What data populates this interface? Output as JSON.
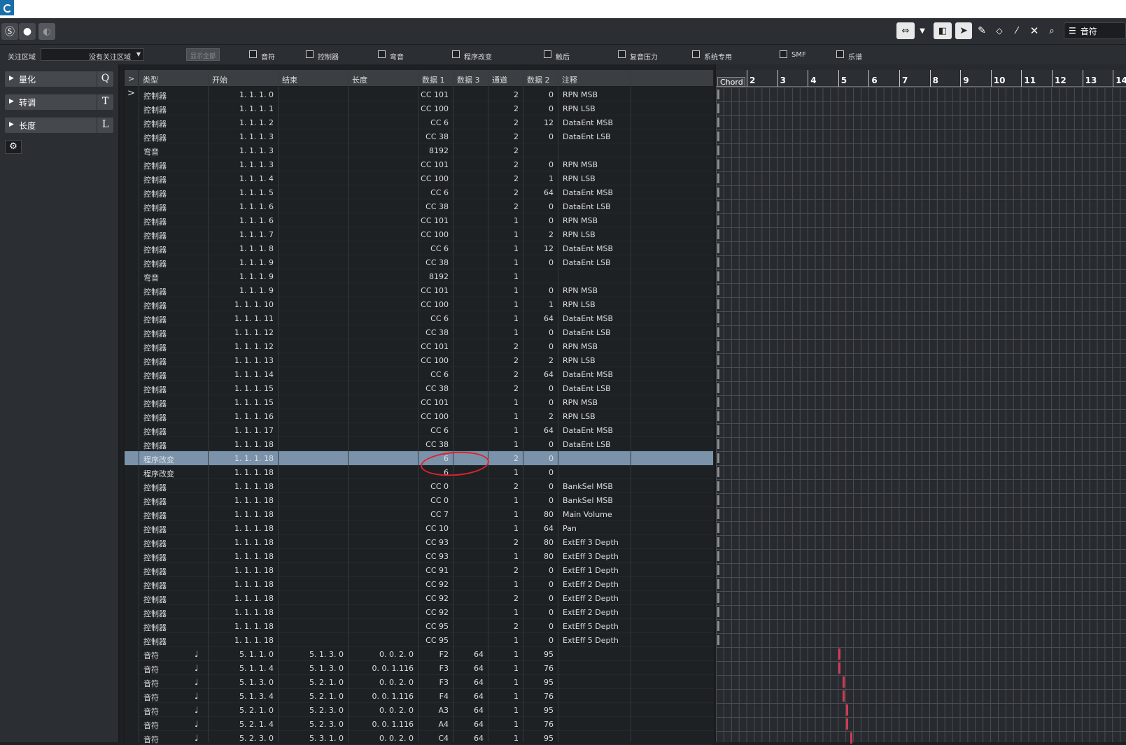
{
  "toolbar": {
    "left_buttons": [
      "solo-icon",
      "record-icon",
      "monitor-icon"
    ],
    "tools": [
      "arrange-icon",
      "chevron-down-icon",
      "mute-icon",
      "pointer-icon",
      "pencil-icon",
      "eraser-icon",
      "knife-icon",
      "cross-icon",
      "zoom-icon"
    ],
    "display_label": "音符"
  },
  "filter": {
    "focus_label": "关注区域",
    "focus_value": "没有关注区域",
    "show_all": "显示全部",
    "checkboxes": [
      "音符",
      "控制器",
      "弯音",
      "程序改变",
      "触后",
      "复音压力",
      "系统专用",
      "SMF",
      "乐谱"
    ]
  },
  "inspector": {
    "sections": [
      {
        "label": "量化",
        "key": "Q"
      },
      {
        "label": "转调",
        "key": "T"
      },
      {
        "label": "长度",
        "key": "L"
      }
    ]
  },
  "list": {
    "expander": ">",
    "columns": [
      "类型",
      "开始",
      "结束",
      "长度",
      "数据 1",
      "数据 3",
      "通道",
      "数据 2",
      "注释"
    ],
    "rows": [
      [
        "控制器",
        "1. 1. 1.   0",
        "",
        "",
        "CC 101",
        "",
        "2",
        "0",
        "RPN MSB"
      ],
      [
        "控制器",
        "1. 1. 1.   1",
        "",
        "",
        "CC 100",
        "",
        "2",
        "0",
        "RPN LSB"
      ],
      [
        "控制器",
        "1. 1. 1.   2",
        "",
        "",
        "CC 6",
        "",
        "2",
        "12",
        "DataEnt MSB"
      ],
      [
        "控制器",
        "1. 1. 1.   3",
        "",
        "",
        "CC 38",
        "",
        "2",
        "0",
        "DataEnt LSB"
      ],
      [
        "弯音",
        "1. 1. 1.   3",
        "",
        "",
        "8192",
        "",
        "2",
        "",
        ""
      ],
      [
        "控制器",
        "1. 1. 1.   3",
        "",
        "",
        "CC 101",
        "",
        "2",
        "0",
        "RPN MSB"
      ],
      [
        "控制器",
        "1. 1. 1.   4",
        "",
        "",
        "CC 100",
        "",
        "2",
        "1",
        "RPN LSB"
      ],
      [
        "控制器",
        "1. 1. 1.   5",
        "",
        "",
        "CC 6",
        "",
        "2",
        "64",
        "DataEnt MSB"
      ],
      [
        "控制器",
        "1. 1. 1.   6",
        "",
        "",
        "CC 38",
        "",
        "2",
        "0",
        "DataEnt LSB"
      ],
      [
        "控制器",
        "1. 1. 1.   6",
        "",
        "",
        "CC 101",
        "",
        "1",
        "0",
        "RPN MSB"
      ],
      [
        "控制器",
        "1. 1. 1.   7",
        "",
        "",
        "CC 100",
        "",
        "1",
        "2",
        "RPN LSB"
      ],
      [
        "控制器",
        "1. 1. 1.   8",
        "",
        "",
        "CC 6",
        "",
        "1",
        "12",
        "DataEnt MSB"
      ],
      [
        "控制器",
        "1. 1. 1.   9",
        "",
        "",
        "CC 38",
        "",
        "1",
        "0",
        "DataEnt LSB"
      ],
      [
        "弯音",
        "1. 1. 1.   9",
        "",
        "",
        "8192",
        "",
        "1",
        "",
        ""
      ],
      [
        "控制器",
        "1. 1. 1.   9",
        "",
        "",
        "CC 101",
        "",
        "1",
        "0",
        "RPN MSB"
      ],
      [
        "控制器",
        "1. 1. 1. 10",
        "",
        "",
        "CC 100",
        "",
        "1",
        "1",
        "RPN LSB"
      ],
      [
        "控制器",
        "1. 1. 1. 11",
        "",
        "",
        "CC 6",
        "",
        "1",
        "64",
        "DataEnt MSB"
      ],
      [
        "控制器",
        "1. 1. 1. 12",
        "",
        "",
        "CC 38",
        "",
        "1",
        "0",
        "DataEnt LSB"
      ],
      [
        "控制器",
        "1. 1. 1. 12",
        "",
        "",
        "CC 101",
        "",
        "2",
        "0",
        "RPN MSB"
      ],
      [
        "控制器",
        "1. 1. 1. 13",
        "",
        "",
        "CC 100",
        "",
        "2",
        "2",
        "RPN LSB"
      ],
      [
        "控制器",
        "1. 1. 1. 14",
        "",
        "",
        "CC 6",
        "",
        "2",
        "64",
        "DataEnt MSB"
      ],
      [
        "控制器",
        "1. 1. 1. 15",
        "",
        "",
        "CC 38",
        "",
        "2",
        "0",
        "DataEnt LSB"
      ],
      [
        "控制器",
        "1. 1. 1. 15",
        "",
        "",
        "CC 101",
        "",
        "1",
        "0",
        "RPN MSB"
      ],
      [
        "控制器",
        "1. 1. 1. 16",
        "",
        "",
        "CC 100",
        "",
        "1",
        "2",
        "RPN LSB"
      ],
      [
        "控制器",
        "1. 1. 1. 17",
        "",
        "",
        "CC 6",
        "",
        "1",
        "64",
        "DataEnt MSB"
      ],
      [
        "控制器",
        "1. 1. 1. 18",
        "",
        "",
        "CC 38",
        "",
        "1",
        "0",
        "DataEnt LSB"
      ],
      [
        "程序改变",
        "1. 1. 1. 18",
        "",
        "",
        "6",
        "",
        "2",
        "0",
        ""
      ],
      [
        "程序改变",
        "1. 1. 1. 18",
        "",
        "",
        "6",
        "",
        "1",
        "0",
        ""
      ],
      [
        "控制器",
        "1. 1. 1. 18",
        "",
        "",
        "CC 0",
        "",
        "2",
        "0",
        "BankSel MSB"
      ],
      [
        "控制器",
        "1. 1. 1. 18",
        "",
        "",
        "CC 0",
        "",
        "1",
        "0",
        "BankSel MSB"
      ],
      [
        "控制器",
        "1. 1. 1. 18",
        "",
        "",
        "CC 7",
        "",
        "1",
        "80",
        "Main Volume"
      ],
      [
        "控制器",
        "1. 1. 1. 18",
        "",
        "",
        "CC 10",
        "",
        "1",
        "64",
        "Pan"
      ],
      [
        "控制器",
        "1. 1. 1. 18",
        "",
        "",
        "CC 93",
        "",
        "2",
        "80",
        "ExtEff 3 Depth"
      ],
      [
        "控制器",
        "1. 1. 1. 18",
        "",
        "",
        "CC 93",
        "",
        "1",
        "80",
        "ExtEff 3 Depth"
      ],
      [
        "控制器",
        "1. 1. 1. 18",
        "",
        "",
        "CC 91",
        "",
        "2",
        "0",
        "ExtEff 1 Depth"
      ],
      [
        "控制器",
        "1. 1. 1. 18",
        "",
        "",
        "CC 92",
        "",
        "1",
        "0",
        "ExtEff 2 Depth"
      ],
      [
        "控制器",
        "1. 1. 1. 18",
        "",
        "",
        "CC 92",
        "",
        "2",
        "0",
        "ExtEff 2 Depth"
      ],
      [
        "控制器",
        "1. 1. 1. 18",
        "",
        "",
        "CC 92",
        "",
        "1",
        "0",
        "ExtEff 2 Depth"
      ],
      [
        "控制器",
        "1. 1. 1. 18",
        "",
        "",
        "CC 95",
        "",
        "2",
        "0",
        "ExtEff 5 Depth"
      ],
      [
        "控制器",
        "1. 1. 1. 18",
        "",
        "",
        "CC 95",
        "",
        "1",
        "0",
        "ExtEff 5 Depth"
      ],
      [
        "音符",
        "5. 1. 1.   0",
        "5. 1. 3.   0",
        "0. 0. 2.   0",
        "F2",
        "64",
        "1",
        "95",
        ""
      ],
      [
        "音符",
        "5. 1. 1.   4",
        "5. 1. 3.   0",
        "0. 0. 1.116",
        "F3",
        "64",
        "1",
        "76",
        ""
      ],
      [
        "音符",
        "5. 1. 3.   0",
        "5. 2. 1.   0",
        "0. 0. 2.   0",
        "F3",
        "64",
        "1",
        "95",
        ""
      ],
      [
        "音符",
        "5. 1. 3.   4",
        "5. 2. 1.   0",
        "0. 0. 1.116",
        "F4",
        "64",
        "1",
        "76",
        ""
      ],
      [
        "音符",
        "5. 2. 1.   0",
        "5. 2. 3.   0",
        "0. 0. 2.   0",
        "A3",
        "64",
        "1",
        "95",
        ""
      ],
      [
        "音符",
        "5. 2. 1.   4",
        "5. 2. 3.   0",
        "0. 0. 1.116",
        "A4",
        "64",
        "1",
        "76",
        ""
      ],
      [
        "音符",
        "5. 2. 3.   0",
        "5. 3. 1.   0",
        "0. 0. 2.   0",
        "C4",
        "64",
        "1",
        "95",
        ""
      ]
    ],
    "selected_row": 26,
    "note_icon": "♩"
  },
  "ruler": {
    "chord_label": "Chord",
    "bars": [
      "2",
      "3",
      "4",
      "5",
      "6",
      "7",
      "8",
      "9",
      "10",
      "11",
      "12",
      "13",
      "14"
    ]
  }
}
